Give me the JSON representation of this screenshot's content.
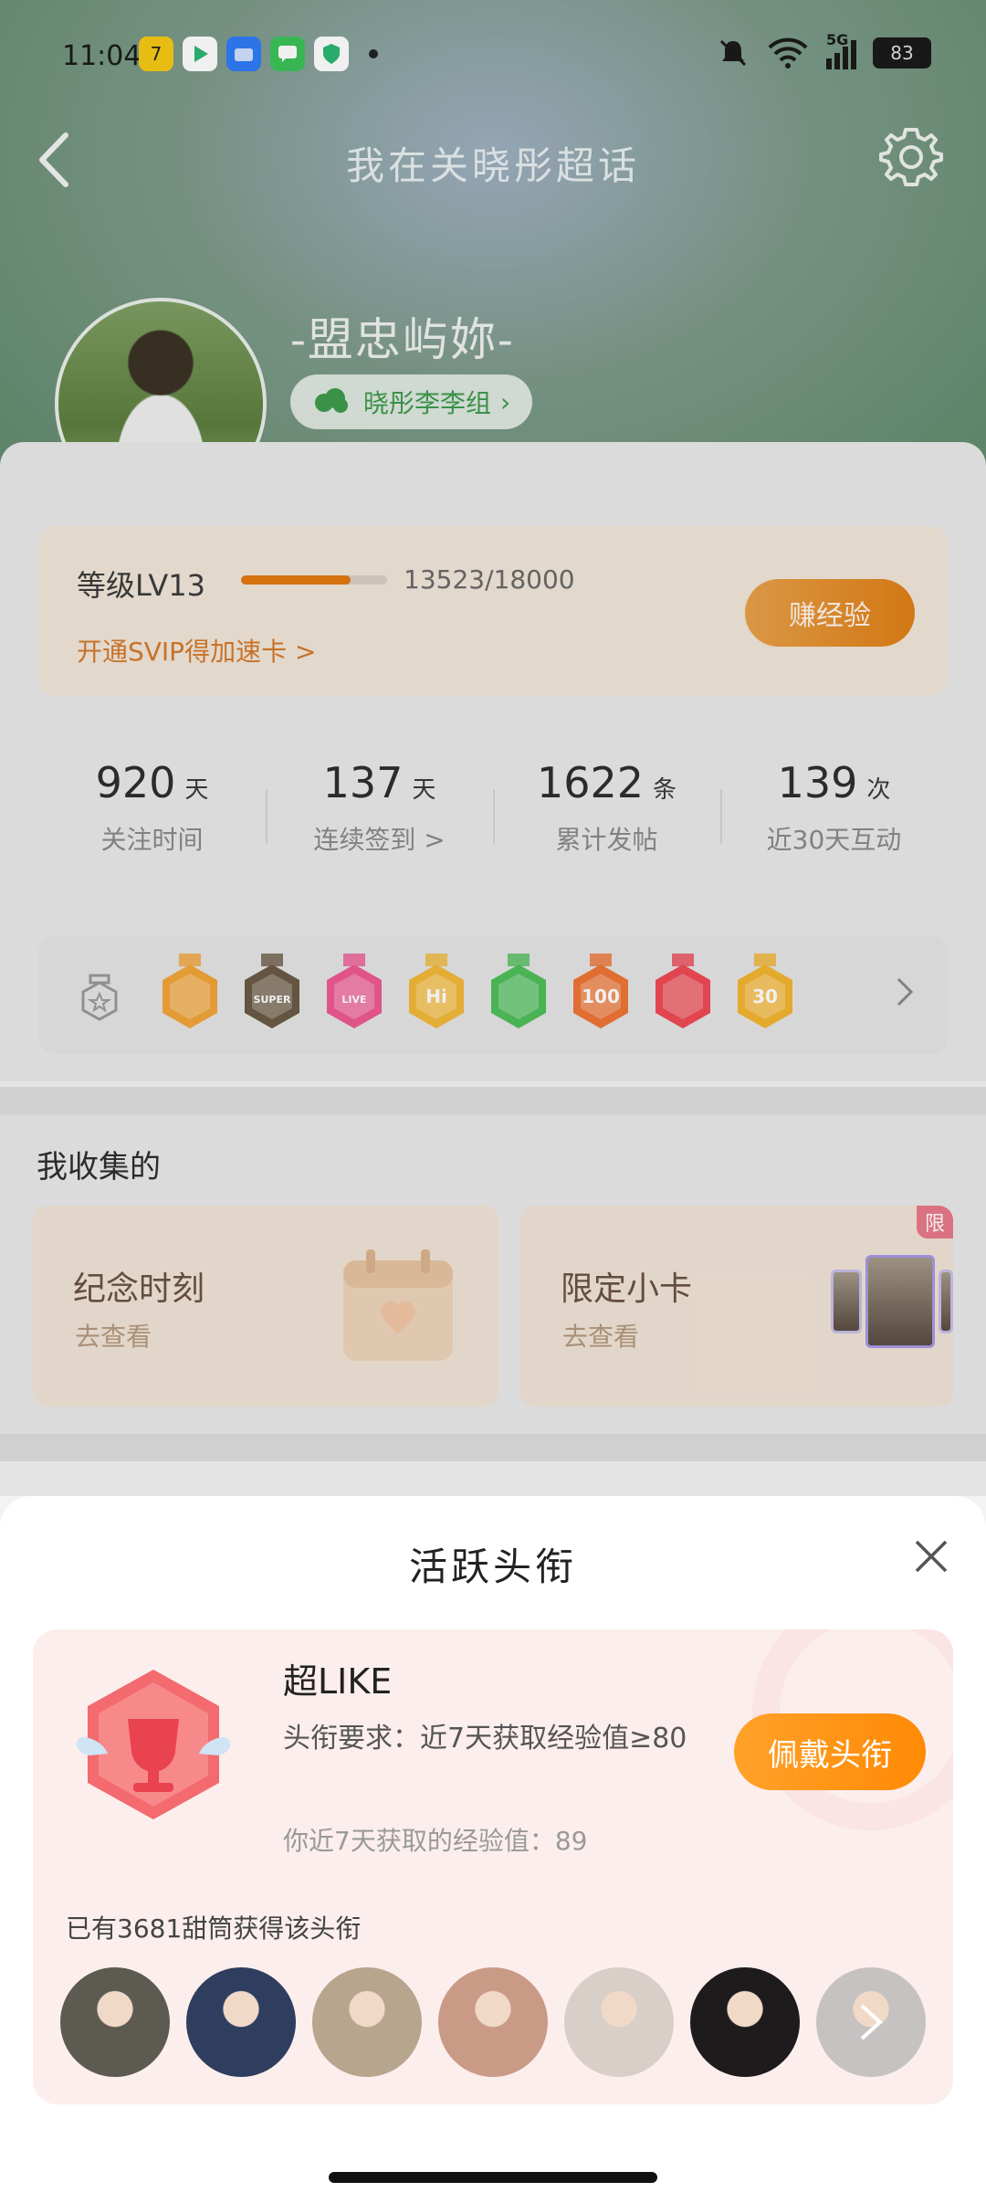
{
  "status": {
    "time": "11:04",
    "network": "5G",
    "battery": "83"
  },
  "nav": {
    "title": "我在关晓彤超话"
  },
  "profile": {
    "username": "-盟忠屿妳-",
    "group": "晓彤李李组"
  },
  "level": {
    "label": "等级LV13",
    "progress_text": "13523/18000",
    "progress_fraction": 0.751,
    "svip_link": "开通SVIP得加速卡 >",
    "earn_button": "赚经验"
  },
  "stats": [
    {
      "value": "920",
      "unit": "天",
      "label": "关注时间"
    },
    {
      "value": "137",
      "unit": "天",
      "label": "连续签到 >"
    },
    {
      "value": "1622",
      "unit": "条",
      "label": "累计发帖"
    },
    {
      "value": "139",
      "unit": "次",
      "label": "近30天互动"
    }
  ],
  "medals": [
    {
      "icon": "crown-medal-icon",
      "color": "#f2a53a",
      "text": ""
    },
    {
      "icon": "super-medal-icon",
      "color": "#6b5a45",
      "text": "SUPER"
    },
    {
      "icon": "live-medal-icon",
      "color": "#ef5a93",
      "text": "LIVE"
    },
    {
      "icon": "hi-medal-icon",
      "color": "#f3b93a",
      "text": "Hi"
    },
    {
      "icon": "hand-medal-icon",
      "color": "#4fbf5a",
      "text": ""
    },
    {
      "icon": "100-days-medal-icon",
      "color": "#ee7436",
      "text": "100"
    },
    {
      "icon": "trophy-medal-icon",
      "color": "#ee4a55",
      "text": ""
    },
    {
      "icon": "30-days-medal-icon",
      "color": "#f3b530",
      "text": "30"
    }
  ],
  "collect": {
    "title": "我收集的",
    "cards": [
      {
        "title": "纪念时刻",
        "sub": "去查看"
      },
      {
        "title": "限定小卡",
        "sub": "去查看",
        "tag": "限"
      }
    ]
  },
  "sheet": {
    "title": "活跃头衔",
    "badge_name": "超LIKE",
    "requirement": "头衔要求：近7天获取经验值≥80",
    "current": "你近7天获取的经验值：89",
    "wear_button": "佩戴头衔",
    "owners_text": "已有3681甜筒获得该头衔"
  },
  "owner_avatars": [
    {
      "color": "#5d5a52"
    },
    {
      "color": "#2f3e5e"
    },
    {
      "color": "#b8a58e"
    },
    {
      "color": "#c99a86"
    },
    {
      "color": "#d8cfc8"
    },
    {
      "color": "#1e1b1c"
    },
    {
      "color": "#c6c2c2"
    }
  ]
}
